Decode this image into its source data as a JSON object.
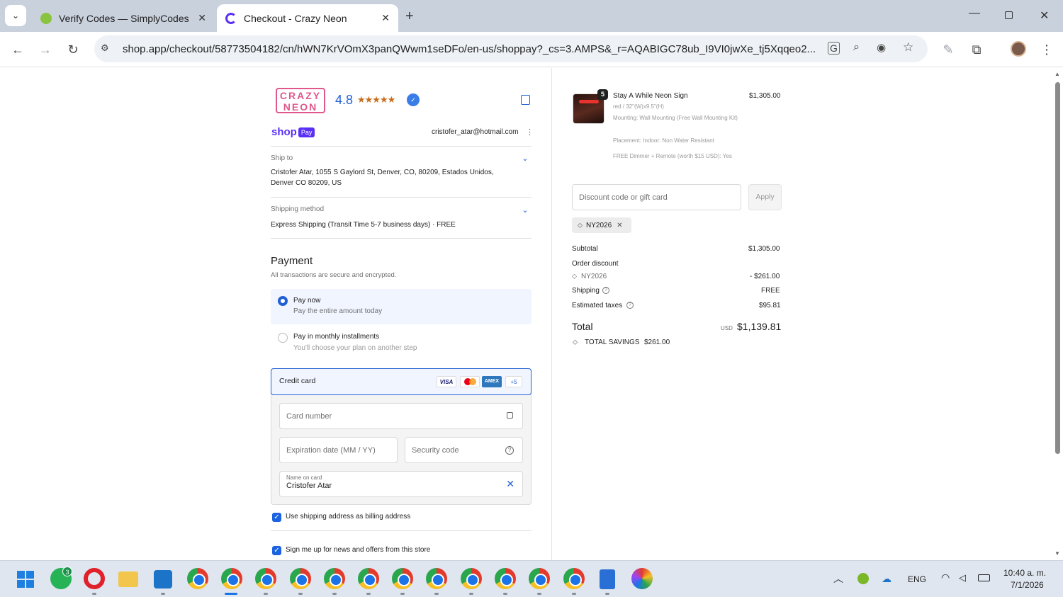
{
  "browser": {
    "tabs": [
      {
        "title": "Verify Codes — SimplyCodes",
        "active": false
      },
      {
        "title": "Checkout - Crazy Neon",
        "active": true
      }
    ],
    "url": "shop.app/checkout/58773504182/cn/hWN7KrVOmX3panQWwm1seDFo/en-us/shoppay?_cs=3.AMPS&_r=AQABIGC78ub_I9VI0jwXe_tj5Xqqeo2..."
  },
  "store": {
    "logo_line1": "CRAZY",
    "logo_line2": "NEON",
    "rating": "4.8",
    "stars": "★★★★★",
    "shop_pay_word": "shop",
    "shop_pay_badge": "Pay",
    "account_email": "cristofer_atar@hotmail.com"
  },
  "ship_to": {
    "label": "Ship to",
    "line1": "Cristofer Atar, 1055 S Gaylord St, Denver, CO, 80209, Estados Unidos,",
    "line2": "Denver CO 80209, US"
  },
  "shipping_method": {
    "label": "Shipping method",
    "value": "Express Shipping (Transit Time 5-7 business days) · FREE"
  },
  "payment": {
    "heading": "Payment",
    "subheading": "All transactions are secure and encrypted.",
    "options": [
      {
        "title": "Pay now",
        "subtitle": "Pay the entire amount today",
        "selected": true
      },
      {
        "title": "Pay in monthly installments",
        "subtitle": "You'll choose your plan on another step",
        "selected": false
      }
    ],
    "credit_card_label": "Credit card",
    "card_brands": [
      "VISA",
      "mastercard",
      "AMEX",
      "+5"
    ],
    "card_number_placeholder": "Card number",
    "expiry_placeholder": "Expiration date (MM / YY)",
    "security_placeholder": "Security code",
    "name_label": "Name on card",
    "name_value": "Cristofer Atar",
    "billing_checkbox": "Use shipping address as billing address",
    "news_checkbox": "Sign me up for news and offers from this store"
  },
  "order": {
    "item": {
      "quantity": "5",
      "name": "Stay A While Neon Sign",
      "variant": "red / 32\"(W)x9.5\"(H)",
      "mounting": "Mounting: Wall Mounting (Free Wall Mounting Kit)",
      "placement": "Placement: Indoor: Non Water Resistant",
      "dimmer": "FREE Dimmer + Remote (worth $15 USD): Yes",
      "price": "$1,305.00"
    },
    "discount_placeholder": "Discount code or gift card",
    "apply_label": "Apply",
    "applied_code": "NY2026",
    "subtotal_label": "Subtotal",
    "subtotal_value": "$1,305.00",
    "order_discount_label": "Order discount",
    "discount_code": "NY2026",
    "discount_value": "- $261.00",
    "shipping_label": "Shipping",
    "shipping_value": "FREE",
    "taxes_label": "Estimated taxes",
    "taxes_value": "$95.81",
    "total_label": "Total",
    "currency": "USD",
    "total_value": "$1,139.81",
    "savings_label": "TOTAL SAVINGS",
    "savings_value": "$261.00"
  },
  "taskbar": {
    "whatsapp_badge": "3",
    "lang": "ENG",
    "time": "10:40 a. m.",
    "date": "7/1/2026"
  },
  "colors": {
    "accent": "#2160d4",
    "shop_pay": "#5a31f4",
    "logo_pink": "#e0578c"
  }
}
